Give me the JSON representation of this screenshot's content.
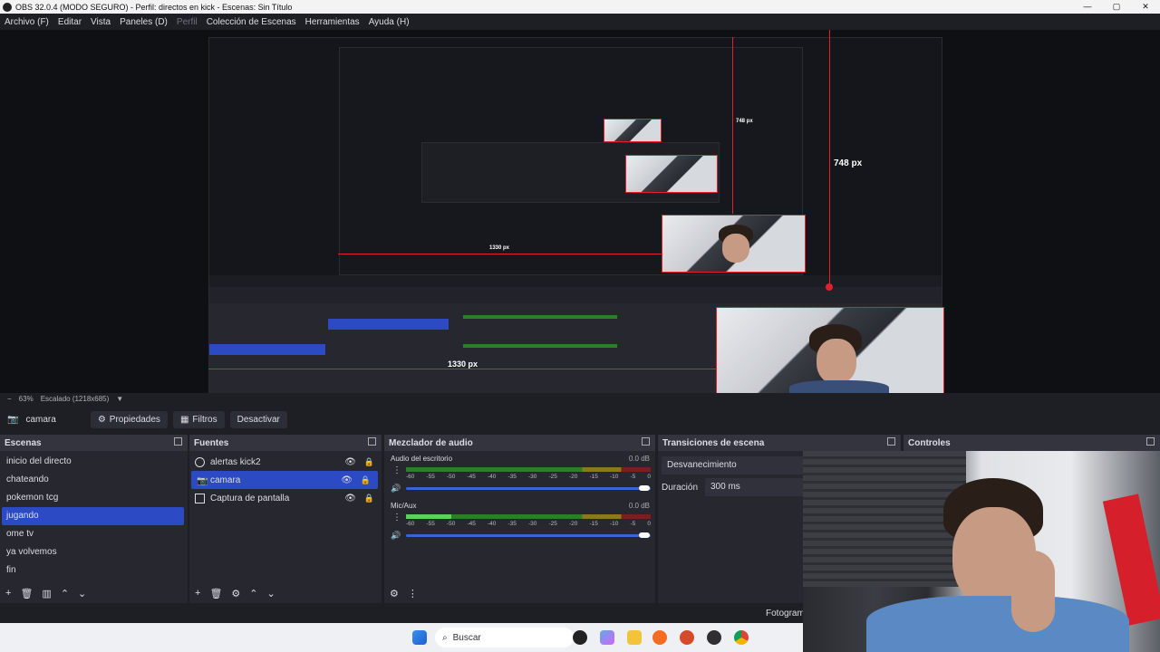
{
  "window": {
    "title": "OBS 32.0.4 (MODO SEGURO) - Perfil: directos en kick - Escenas: Sin Título",
    "controls": {
      "minimize": "—",
      "maximize": "▢",
      "close": "✕"
    }
  },
  "menu": {
    "items": [
      "Archivo (F)",
      "Editar",
      "Vista",
      "Paneles (D)",
      "Perfil",
      "Colección de Escenas",
      "Herramientas",
      "Ayuda (H)"
    ]
  },
  "preview": {
    "measure_vertical": "748 px",
    "measure_horizontal": "1330 px",
    "nested_measure_vertical": "748 px",
    "nested_measure_horizontal": "1330 px"
  },
  "zoom": {
    "minus": "−",
    "level": "63%",
    "mode": "Escalado (1218x685)"
  },
  "source_toolbar": {
    "source_name": "camara",
    "properties": "Propiedades",
    "filters": "Filtros",
    "deactivate": "Desactivar"
  },
  "scenes": {
    "title": "Escenas",
    "items": [
      "inicio del directo",
      "chateando",
      "pokemon tcg",
      "jugando",
      "ome tv",
      "ya volvemos",
      "fin"
    ],
    "selected_index": 3
  },
  "sources": {
    "title": "Fuentes",
    "items": [
      "alertas kick2",
      "camara",
      "Captura de pantalla"
    ],
    "selected_index": 1
  },
  "mixer": {
    "title": "Mezclador de audio",
    "channels": [
      {
        "name": "Audio del escritorio",
        "level": "0.0 dB"
      },
      {
        "name": "Mic/Aux",
        "level": "0.0 dB"
      }
    ],
    "ticks": [
      "-60",
      "-55",
      "-50",
      "-45",
      "-40",
      "-35",
      "-30",
      "-25",
      "-20",
      "-15",
      "-10",
      "-5",
      "0"
    ]
  },
  "transitions": {
    "title": "Transiciones de escena",
    "type": "Desvanecimiento",
    "duration_label": "Duración",
    "duration_value": "300 ms"
  },
  "controls": {
    "title": "Controles",
    "partial_label": "Fotogram"
  },
  "taskbar": {
    "search_placeholder": "Buscar"
  }
}
